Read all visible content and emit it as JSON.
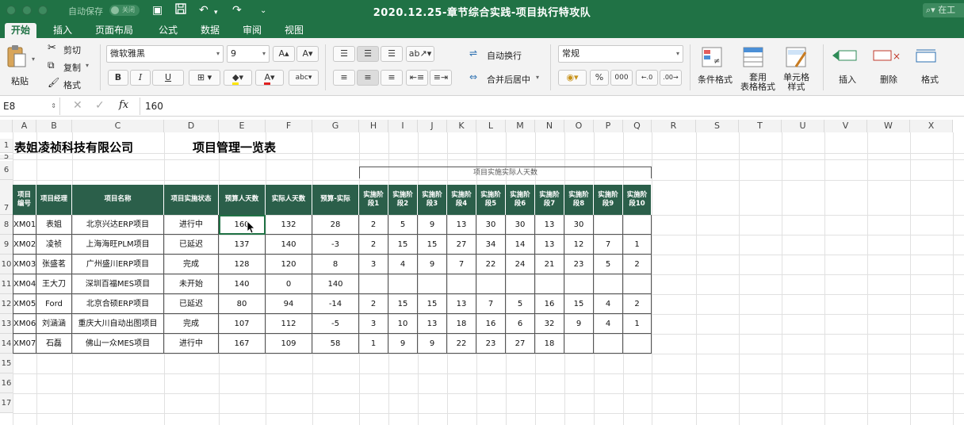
{
  "titlebar": {
    "autosave_label": "自动保存",
    "autosave_state": "关闭",
    "doc_title": "2020.12.25-章节综合实践-项目执行特攻队",
    "search_text": "在工"
  },
  "tabs": [
    {
      "label": "开始"
    },
    {
      "label": "插入"
    },
    {
      "label": "页面布局"
    },
    {
      "label": "公式"
    },
    {
      "label": "数据"
    },
    {
      "label": "审阅"
    },
    {
      "label": "视图"
    }
  ],
  "ribbon": {
    "paste_label": "粘贴",
    "cut_label": "剪切",
    "copy_label": "复制",
    "format_painter_label": "格式",
    "font_name": "微软雅黑",
    "font_size": "9",
    "bold": "B",
    "italic": "I",
    "underline": "U",
    "wrap_label": "自动换行",
    "merge_label": "合并后居中",
    "number_format": "常规",
    "percent": "%",
    "comma": "000",
    "cond_format_label": "条件格式",
    "table_format_label": "套用\n表格格式",
    "cell_style_label": "单元格\n样式",
    "insert_label": "插入",
    "delete_label": "删除",
    "format_label": "格式"
  },
  "formula_bar": {
    "name_box": "E8",
    "fx": "fx",
    "formula": "160"
  },
  "sheet": {
    "column_letters": [
      "A",
      "B",
      "C",
      "D",
      "E",
      "F",
      "G",
      "H",
      "I",
      "J",
      "K",
      "L",
      "M",
      "N",
      "O",
      "P",
      "Q",
      "R",
      "S",
      "T",
      "U",
      "V",
      "W",
      "X"
    ],
    "row_numbers": [
      "1",
      "5",
      "6",
      "7",
      "8",
      "9",
      "10",
      "11",
      "12",
      "13",
      "14",
      "15",
      "16",
      "17"
    ],
    "company": "表姐凌祯科技有限公司",
    "table_title": "项目管理一览表",
    "group_header": "项目实施实际人天数",
    "headers": [
      "项目\n编号",
      "项目经理",
      "项目名称",
      "项目实施状态",
      "预算人天数",
      "实际人天数",
      "预算-实际",
      "实施阶\n段1",
      "实施阶\n段2",
      "实施阶\n段3",
      "实施阶\n段4",
      "实施阶\n段5",
      "实施阶\n段6",
      "实施阶\n段7",
      "实施阶\n段8",
      "实施阶\n段9",
      "实施阶\n段10"
    ],
    "rows": [
      [
        "XM01",
        "表姐",
        "北京兴达ERP项目",
        "进行中",
        "160",
        "132",
        "28",
        "2",
        "5",
        "9",
        "13",
        "30",
        "30",
        "13",
        "30",
        "",
        ""
      ],
      [
        "XM02",
        "凌祯",
        "上海海旺PLM项目",
        "已延迟",
        "137",
        "140",
        "-3",
        "2",
        "15",
        "15",
        "27",
        "34",
        "14",
        "13",
        "12",
        "7",
        "1"
      ],
      [
        "XM03",
        "张盛茗",
        "广州盛川ERP项目",
        "完成",
        "128",
        "120",
        "8",
        "3",
        "4",
        "9",
        "7",
        "22",
        "24",
        "21",
        "23",
        "5",
        "2"
      ],
      [
        "XM04",
        "王大刀",
        "深圳百福MES项目",
        "未开始",
        "140",
        "0",
        "140",
        "",
        "",
        "",
        "",
        "",
        "",
        "",
        "",
        "",
        ""
      ],
      [
        "XM05",
        "Ford",
        "北京合硕ERP项目",
        "已延迟",
        "80",
        "94",
        "-14",
        "2",
        "15",
        "15",
        "13",
        "7",
        "5",
        "16",
        "15",
        "4",
        "2"
      ],
      [
        "XM06",
        "刘涵涵",
        "重庆大川自动出图项目",
        "完成",
        "107",
        "112",
        "-5",
        "3",
        "10",
        "13",
        "18",
        "16",
        "6",
        "32",
        "9",
        "4",
        "1"
      ],
      [
        "XM07",
        "石磊",
        "佛山一众MES项目",
        "进行中",
        "167",
        "109",
        "58",
        "1",
        "9",
        "9",
        "22",
        "23",
        "27",
        "18",
        "",
        "",
        ""
      ]
    ]
  },
  "colors": {
    "title_green": "#207245",
    "header_fill": "#2b5f4a",
    "ribbon_bg": "#f3f3f3"
  }
}
